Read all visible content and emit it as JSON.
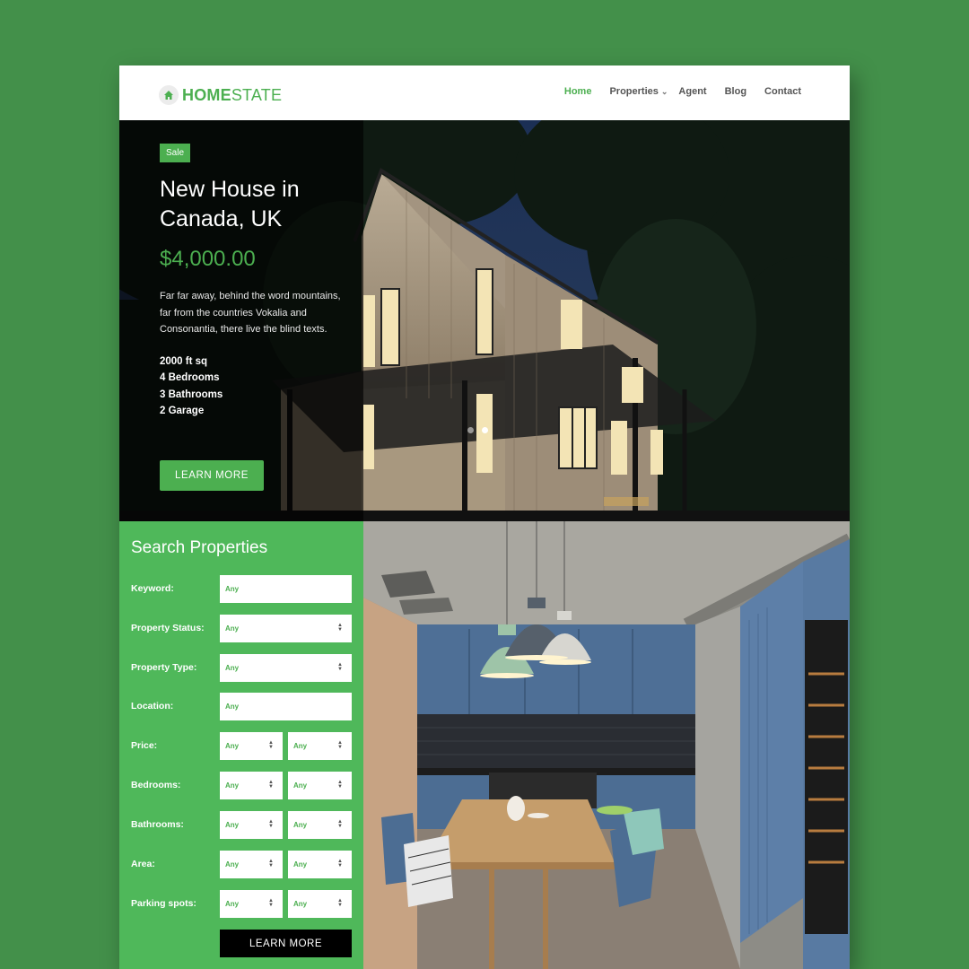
{
  "header": {
    "logo_bold": "HOME",
    "logo_light": "STATE",
    "nav": [
      {
        "label": "Home",
        "active": true
      },
      {
        "label": "Properties",
        "has_dropdown": true
      },
      {
        "label": "Agent"
      },
      {
        "label": "Blog"
      },
      {
        "label": "Contact"
      }
    ]
  },
  "hero": {
    "badge": "Sale",
    "title_line1": "New House in",
    "title_line2": "Canada, UK",
    "price": "$4,000.00",
    "description": "Far far away, behind the word mountains, far from the countries Vokalia and Consonantia, there live the blind texts.",
    "specs": [
      "2000 ft sq",
      "4 Bedrooms",
      "3 Bathrooms",
      "2 Garage"
    ],
    "button": "LEARN MORE",
    "slides": 3,
    "active_slide": 2
  },
  "search": {
    "title": "Search Properties",
    "fields": [
      {
        "label": "Keyword:",
        "type": "text",
        "values": [
          "Any"
        ]
      },
      {
        "label": "Property Status:",
        "type": "select",
        "values": [
          "Any"
        ]
      },
      {
        "label": "Property Type:",
        "type": "select",
        "values": [
          "Any"
        ]
      },
      {
        "label": "Location:",
        "type": "text",
        "values": [
          "Any"
        ]
      },
      {
        "label": "Price:",
        "type": "select-pair",
        "values": [
          "Any",
          "Any"
        ]
      },
      {
        "label": "Bedrooms:",
        "type": "select-pair",
        "values": [
          "Any",
          "Any"
        ]
      },
      {
        "label": "Bathrooms:",
        "type": "select-pair",
        "values": [
          "Any",
          "Any"
        ]
      },
      {
        "label": "Area:",
        "type": "select-pair",
        "values": [
          "Any",
          "Any"
        ]
      },
      {
        "label": "Parking spots:",
        "type": "select-pair",
        "values": [
          "Any",
          "Any"
        ]
      }
    ],
    "button": "LEARN MORE"
  },
  "colors": {
    "background": "#43904a",
    "accent": "#4caf50",
    "search_panel": "#4fb85a",
    "button_dark": "#000000"
  }
}
